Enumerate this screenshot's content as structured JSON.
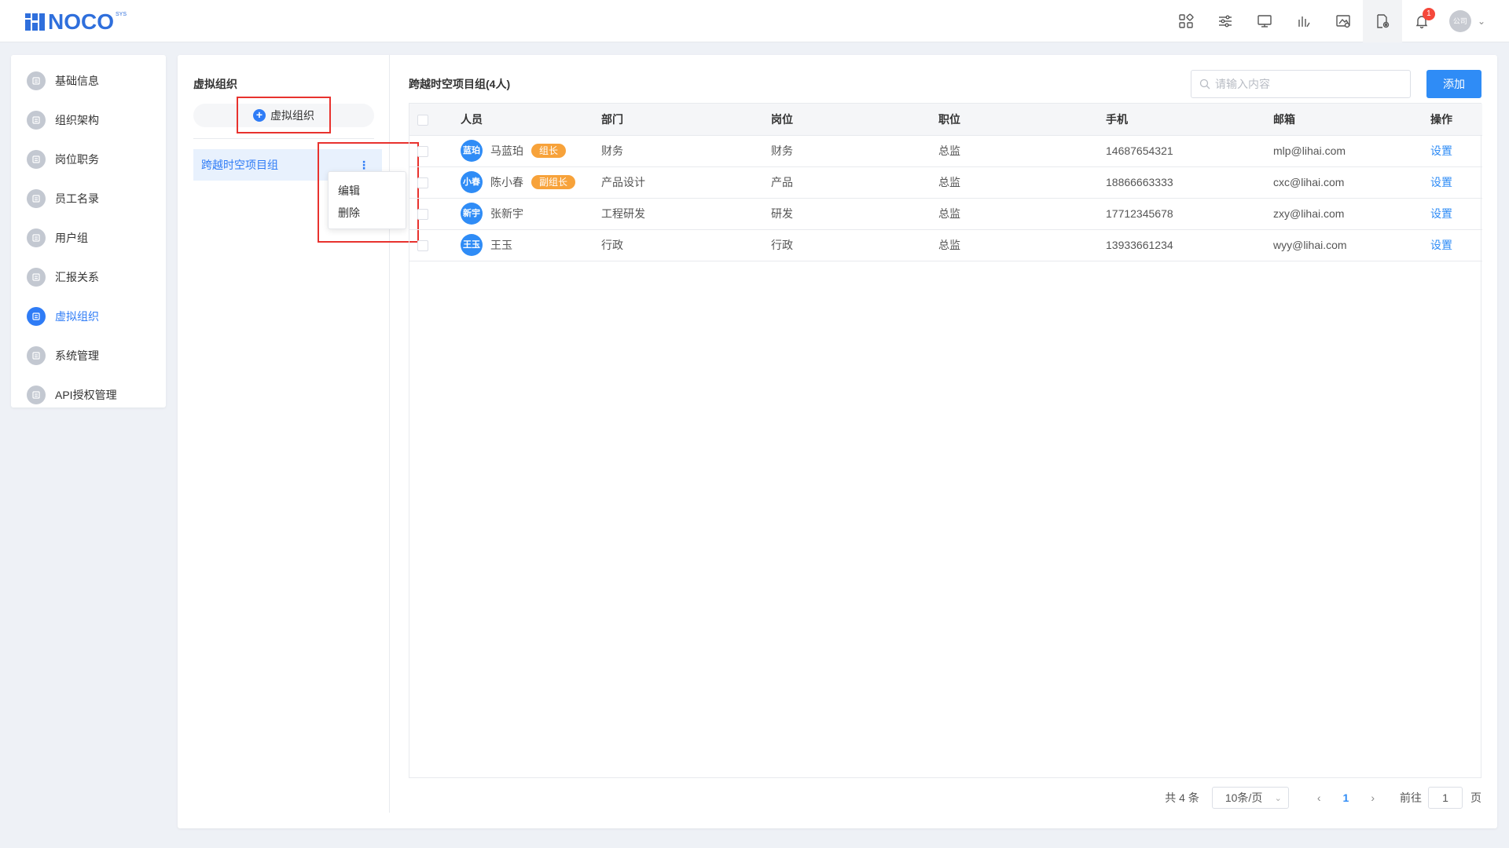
{
  "header": {
    "logo_text": "NOCO",
    "logo_sup": "SYS",
    "icons": [
      "apps-icon",
      "sliders-icon",
      "monitor-icon",
      "chart-icon",
      "image-check-icon",
      "file-settings-icon",
      "bell-icon"
    ],
    "notification_count": "1",
    "avatar_text": "公司"
  },
  "nav": {
    "items": [
      {
        "label": "基础信息",
        "icon": "document-icon"
      },
      {
        "label": "组织架构",
        "icon": "org-chart-icon"
      },
      {
        "label": "岗位职务",
        "icon": "id-card-icon"
      },
      {
        "label": "员工名录",
        "icon": "contacts-icon"
      },
      {
        "label": "用户组",
        "icon": "user-group-icon"
      },
      {
        "label": "汇报关系",
        "icon": "report-icon"
      },
      {
        "label": "虚拟组织",
        "icon": "layers-icon",
        "active": true
      },
      {
        "label": "系统管理",
        "icon": "user-settings-icon"
      },
      {
        "label": "API授权管理",
        "icon": "link-icon"
      }
    ]
  },
  "groups": {
    "title": "虚拟组织",
    "add_label": "虚拟组织",
    "selected": "跨越时空项目组",
    "menu": [
      "编辑",
      "删除"
    ]
  },
  "content": {
    "title": "跨越时空项目组(4人)",
    "search_placeholder": "请输入内容",
    "add_button": "添加",
    "columns": [
      "人员",
      "部门",
      "岗位",
      "职位",
      "手机",
      "邮箱",
      "操作"
    ],
    "rows": [
      {
        "avatar": "蓝珀",
        "name": "马蓝珀",
        "tag": "组长",
        "dept": "财务",
        "post": "财务",
        "position": "总监",
        "phone": "14687654321",
        "email": "mlp@lihai.com",
        "action": "设置"
      },
      {
        "avatar": "小春",
        "name": "陈小春",
        "tag": "副组长",
        "dept": "产品设计",
        "post": "产品",
        "position": "总监",
        "phone": "18866663333",
        "email": "cxc@lihai.com",
        "action": "设置"
      },
      {
        "avatar": "新宇",
        "name": "张新宇",
        "tag": "",
        "dept": "工程研发",
        "post": "研发",
        "position": "总监",
        "phone": "17712345678",
        "email": "zxy@lihai.com",
        "action": "设置"
      },
      {
        "avatar": "王玉",
        "name": "王玉",
        "tag": "",
        "dept": "行政",
        "post": "行政",
        "position": "总监",
        "phone": "13933661234",
        "email": "wyy@lihai.com",
        "action": "设置"
      }
    ]
  },
  "pagination": {
    "total": "共 4 条",
    "page_size": "10条/页",
    "current": "1",
    "goto_label": "前往",
    "goto_value": "1",
    "page_suffix": "页"
  }
}
